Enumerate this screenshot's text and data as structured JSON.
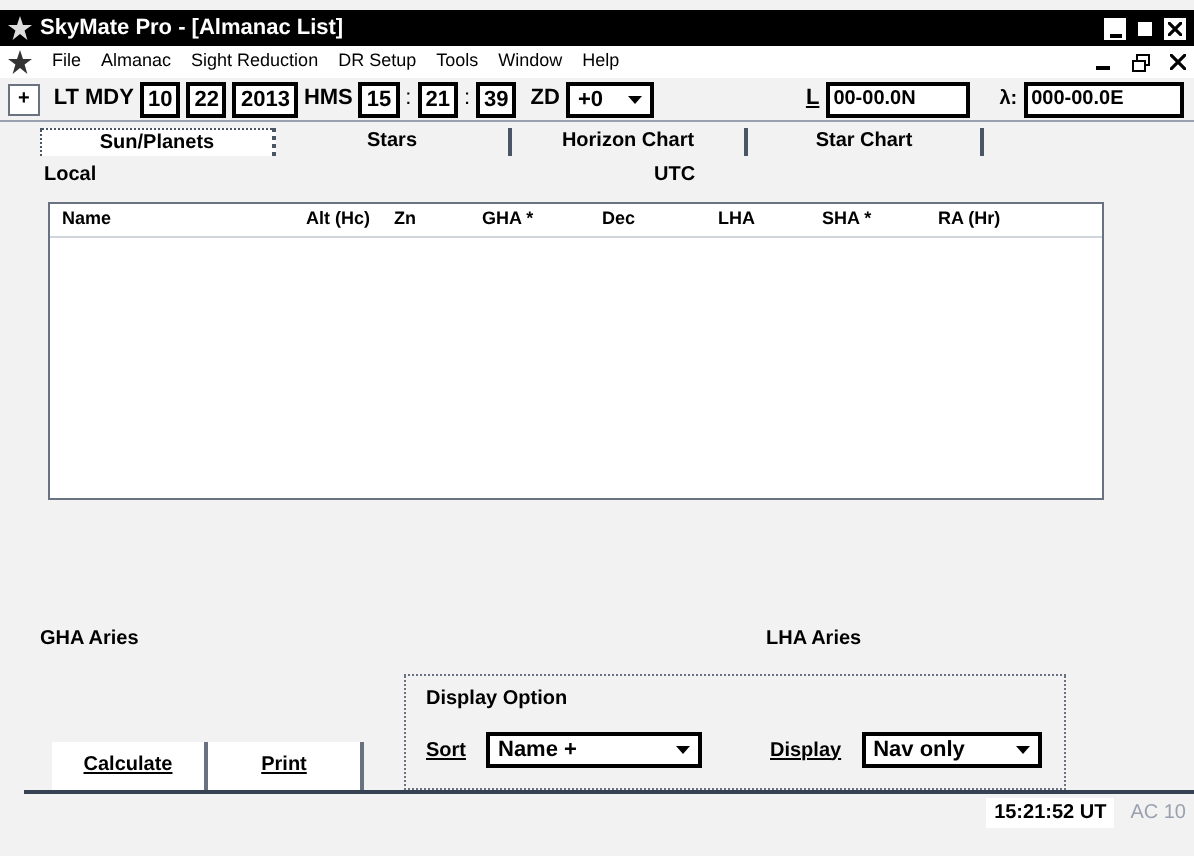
{
  "window": {
    "title": "SkyMate Pro - [Almanac List]"
  },
  "menu": [
    "File",
    "Almanac",
    "Sight Reduction",
    "DR Setup",
    "Tools",
    "Window",
    "Help"
  ],
  "toolbar": {
    "button": "+",
    "lt_label": "LT MDY",
    "month": "10",
    "day": "22",
    "year": "2013",
    "hms_label": "HMS",
    "hour": "15",
    "minute": "21",
    "second": "39",
    "sep1": ":",
    "sep2": ":",
    "zd_label": "ZD",
    "zd_value": "+0",
    "lat_label": "L",
    "lat": "00-00.0N",
    "lon_label": "λ:",
    "lon": "000-00.0E"
  },
  "tabs": [
    {
      "label": "Sun/Planets",
      "selected": true
    },
    {
      "label": "Stars",
      "selected": false
    },
    {
      "label": "Horizon Chart",
      "selected": false
    },
    {
      "label": "Star Chart",
      "selected": false
    }
  ],
  "local_label": "Local",
  "utc_label": "UTC",
  "table": {
    "columns": [
      "Name",
      "Alt (Hc)",
      "Zn",
      "GHA *",
      "Dec",
      "LHA",
      "SHA *",
      "RA (Hr)"
    ]
  },
  "gha_aries_label": "GHA Aries",
  "lha_aries_label": "LHA Aries",
  "display_option": {
    "title": "Display Option",
    "sort_label": "Sort",
    "sort_value": "Name +",
    "display_label": "Display",
    "display_value": "Nav only"
  },
  "buttons": [
    "Calculate",
    "Print"
  ],
  "status_bar": {
    "time": "15:21:52 UT",
    "extra": "AC 10"
  }
}
